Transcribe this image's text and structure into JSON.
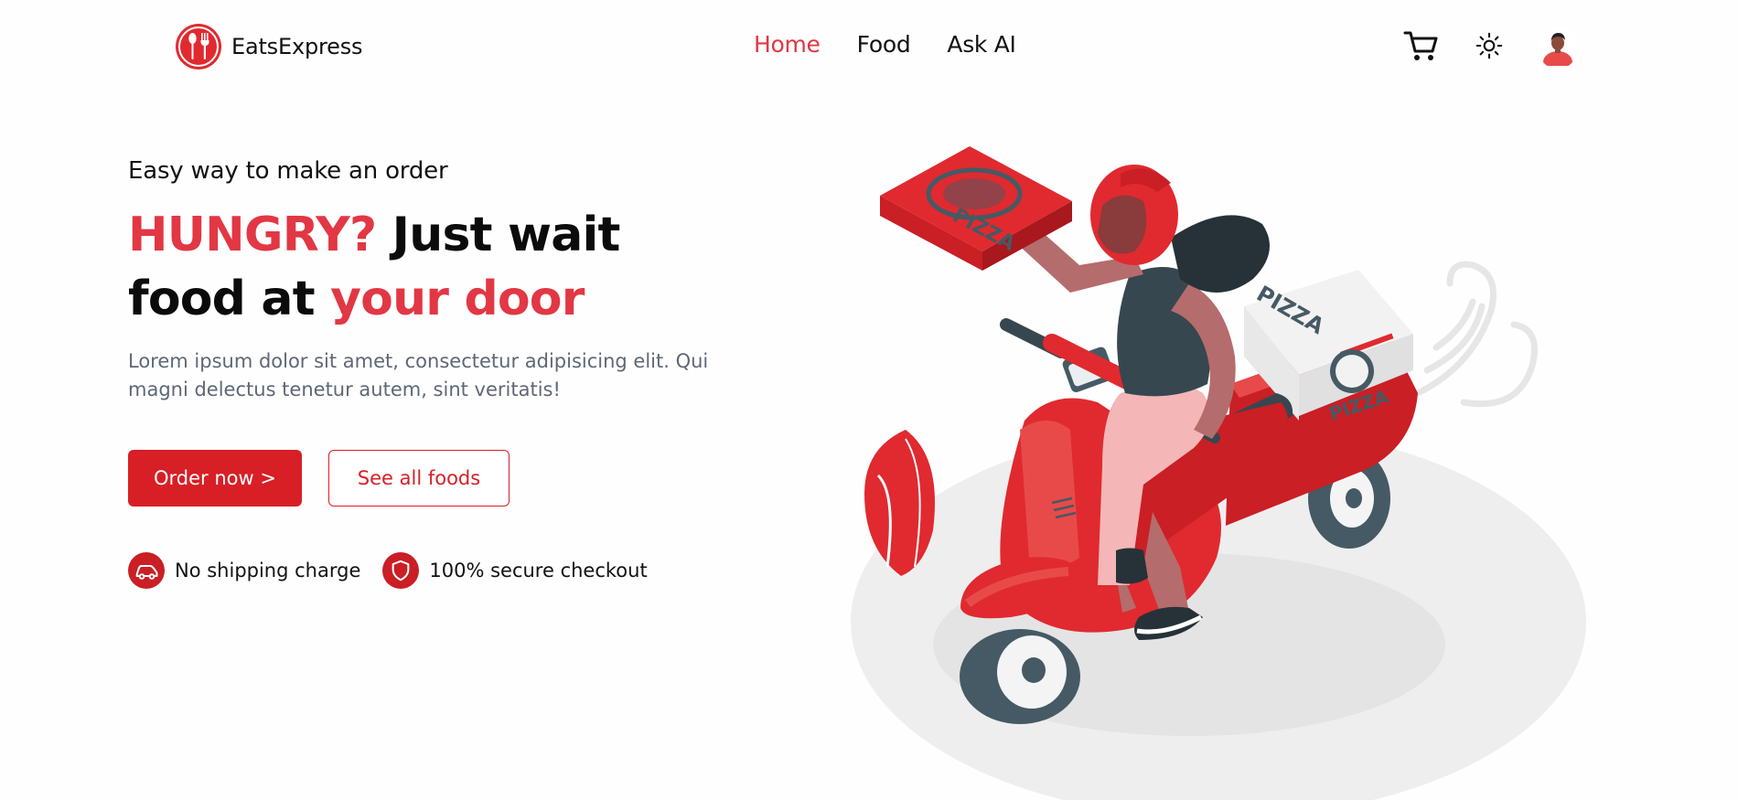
{
  "header": {
    "brand": {
      "name": "EatsExpress",
      "logo_icon": "fork-spoon-icon"
    },
    "nav": [
      {
        "label": "Home",
        "active": true
      },
      {
        "label": "Food",
        "active": false
      },
      {
        "label": "Ask AI",
        "active": false
      }
    ],
    "tools": {
      "cart_icon": "cart-icon",
      "theme_icon": "sun-icon",
      "avatar_icon": "user-avatar"
    }
  },
  "hero": {
    "eyebrow": "Easy way to make an order",
    "headline": {
      "part1": "HUNGRY?",
      "part2": " Just wait",
      "part3": "food at ",
      "part4": "your door"
    },
    "description": "Lorem ipsum dolor sit amet, consectetur adipisicing elit. Qui magni delectus tenetur autem, sint veritatis!",
    "primary_button": "Order now >",
    "secondary_button": "See all foods",
    "features": [
      {
        "icon": "car-icon",
        "label": "No shipping charge"
      },
      {
        "icon": "shield-icon",
        "label": "100% secure checkout"
      }
    ],
    "illustration": {
      "description_icon": "delivery-scooter-illustration",
      "box_text": "PIZZA"
    }
  },
  "colors": {
    "accent": "#e23744",
    "button": "#d81f26",
    "muted_text": "#5f6776"
  }
}
